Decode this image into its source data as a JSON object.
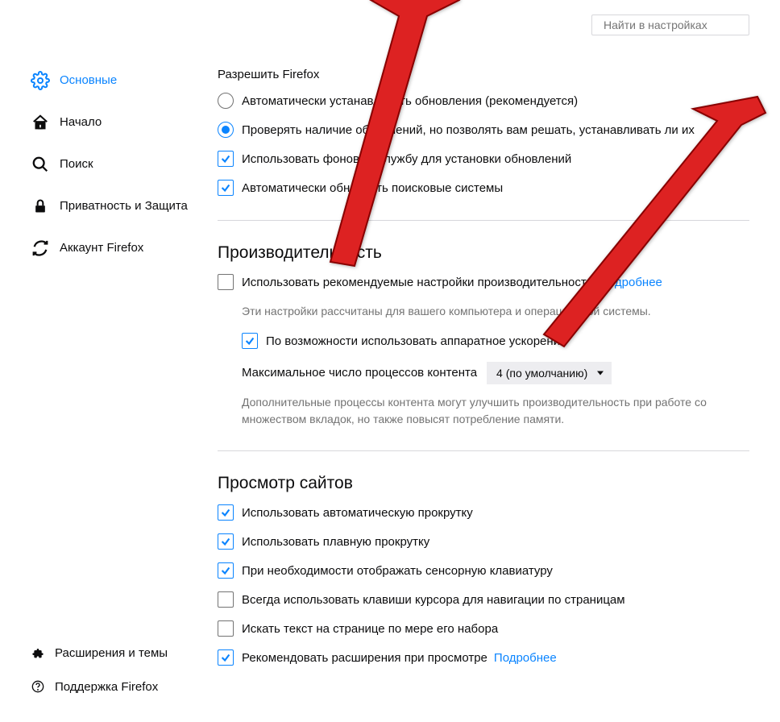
{
  "search": {
    "placeholder": "Найти в настройках"
  },
  "sidebar": {
    "items": [
      {
        "label": "Основные"
      },
      {
        "label": "Начало"
      },
      {
        "label": "Поиск"
      },
      {
        "label": "Приватность и Защита"
      },
      {
        "label": "Аккаунт Firefox"
      }
    ],
    "footer": [
      {
        "label": "Расширения и темы"
      },
      {
        "label": "Поддержка Firefox"
      }
    ]
  },
  "updates": {
    "group_label": "Разрешить Firefox",
    "auto_install": "Автоматически устанавливать обновления (рекомендуется)",
    "check_only": "Проверять наличие обновлений, но позволять вам решать, устанавливать ли их",
    "background_service": "Использовать фоновую службу для установки обновлений",
    "auto_search_engines": "Автоматически обновлять поисковые системы"
  },
  "performance": {
    "heading": "Производительность",
    "use_recommended": "Использовать рекомендуемые настройки производительности",
    "learn_more": "Подробнее",
    "hint1": "Эти настройки рассчитаны для вашего компьютера и операционной системы.",
    "hw_accel": "По возможности использовать аппаратное ускорение",
    "max_processes_label": "Максимальное число процессов контента",
    "max_processes_value": "4 (по умолчанию)",
    "hint2": "Дополнительные процессы контента могут улучшить производительность при работе со множеством вкладок, но также повысят потребление памяти."
  },
  "browsing": {
    "heading": "Просмотр сайтов",
    "autoscroll": "Использовать автоматическую прокрутку",
    "smooth_scroll": "Использовать плавную прокрутку",
    "touch_keyboard": "При необходимости отображать сенсорную клавиатуру",
    "caret_browsing": "Всегда использовать клавиши курсора для навигации по страницам",
    "search_on_type": "Искать текст на странице по мере его набора",
    "recommend_ext": "Рекомендовать расширения при просмотре",
    "learn_more": "Подробнее"
  }
}
